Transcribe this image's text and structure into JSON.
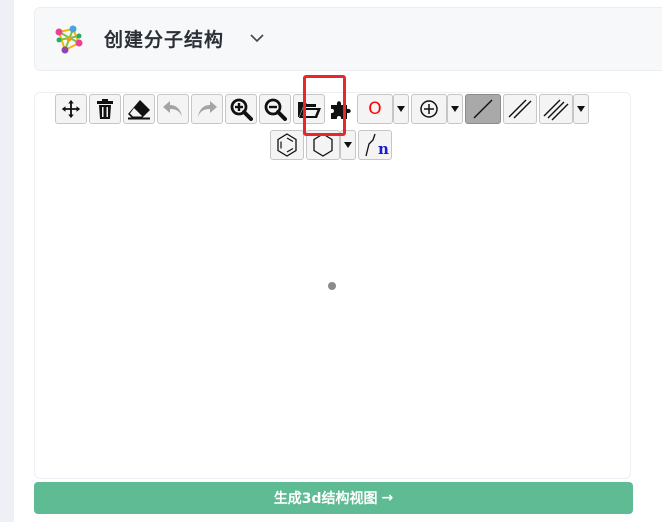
{
  "header": {
    "title": "创建分子结构",
    "dropdown_icon": "chevron-down-icon"
  },
  "toolbar": {
    "row1": [
      {
        "name": "move-tool-button",
        "icon": "move-icon",
        "enabled": true
      },
      {
        "name": "clear-button",
        "icon": "trash-icon",
        "enabled": true
      },
      {
        "name": "erase-button",
        "icon": "eraser-icon",
        "enabled": true
      },
      {
        "name": "undo-button",
        "icon": "undo-icon",
        "enabled": false
      },
      {
        "name": "redo-button",
        "icon": "redo-icon",
        "enabled": false
      },
      {
        "name": "zoom-in-button",
        "icon": "zoom-in-icon",
        "enabled": true
      },
      {
        "name": "zoom-out-button",
        "icon": "zoom-out-icon",
        "enabled": true
      },
      {
        "name": "open-file-button",
        "icon": "folder-open-icon",
        "enabled": true,
        "highlighted": true
      },
      {
        "name": "template-button",
        "icon": "puzzle-icon",
        "enabled": true
      },
      {
        "name": "element-button",
        "label": "O"
      },
      {
        "name": "charge-button",
        "icon": "circle-plus-icon"
      },
      {
        "name": "single-bond-button",
        "icon": "single-bond-icon",
        "active": true
      },
      {
        "name": "double-bond-button",
        "icon": "double-bond-icon"
      },
      {
        "name": "triple-bond-button",
        "icon": "triple-bond-icon"
      }
    ],
    "row2": [
      {
        "name": "benzene-button",
        "icon": "benzene-icon"
      },
      {
        "name": "ring-button",
        "icon": "hexagon-icon"
      },
      {
        "name": "chain-button",
        "icon": "chain-icon",
        "label": "n"
      }
    ],
    "element_label": "O",
    "chain_label": "n"
  },
  "footer": {
    "generate_label": "生成3d结构视图",
    "arrow": "→"
  },
  "colors": {
    "accent": "#5fbb93",
    "highlight": "#e8262b",
    "element_oxygen": "#ff0000"
  }
}
